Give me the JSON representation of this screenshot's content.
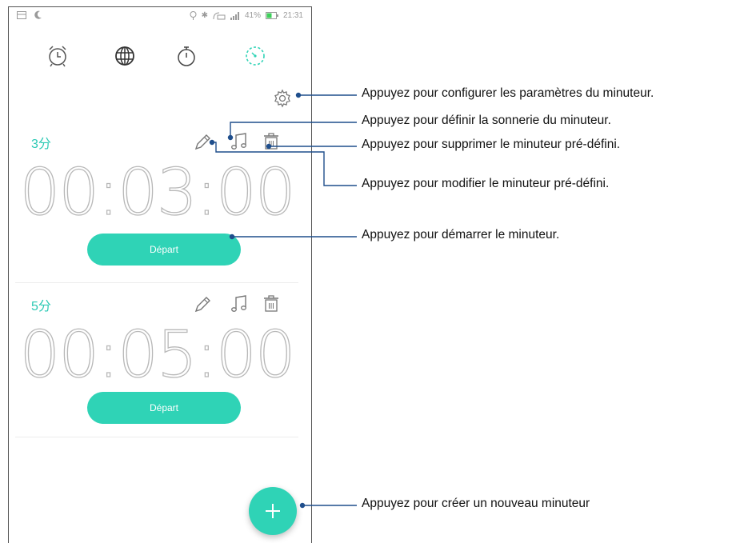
{
  "statusbar": {
    "battery": "41%",
    "time": "21:31"
  },
  "tabs": [
    {
      "name": "alarm-clock-icon"
    },
    {
      "name": "world-clock-icon"
    },
    {
      "name": "stopwatch-icon"
    },
    {
      "name": "timer-icon",
      "active": true
    }
  ],
  "timers": [
    {
      "label": "3分",
      "time": "00:03:00",
      "start_label": "Départ"
    },
    {
      "label": "5分",
      "time": "00:05:00",
      "start_label": "Départ"
    }
  ],
  "annotations": {
    "settings": "Appuyez pour configurer les paramètres du minuteur.",
    "ringtone": "Appuyez pour définir la sonnerie du minuteur.",
    "delete": "Appuyez pour supprimer le minuteur pré-défini.",
    "edit": "Appuyez pour modifier le minuteur pré-défini.",
    "start": "Appuyez pour démarrer le minuteur.",
    "add": "Appuyez pour créer un nouveau minuteur"
  },
  "colors": {
    "accent": "#2fd3b6",
    "callout_line": "#1f4e8c"
  }
}
